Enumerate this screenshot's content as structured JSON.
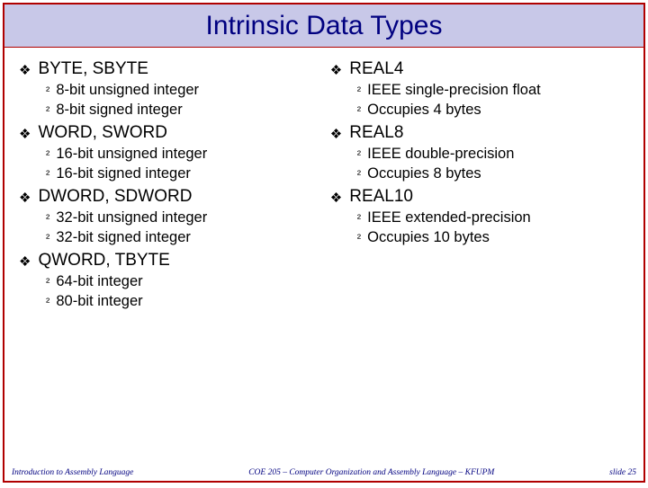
{
  "title": "Intrinsic Data Types",
  "left": [
    {
      "label": "BYTE, SBYTE",
      "sub": [
        "8-bit unsigned integer",
        "8-bit signed integer"
      ]
    },
    {
      "label": "WORD, SWORD",
      "sub": [
        "16-bit unsigned integer",
        "16-bit signed integer"
      ]
    },
    {
      "label": "DWORD, SDWORD",
      "sub": [
        "32-bit unsigned integer",
        "32-bit signed integer"
      ]
    },
    {
      "label": "QWORD, TBYTE",
      "sub": [
        "64-bit integer",
        "80-bit integer"
      ]
    }
  ],
  "right": [
    {
      "label": "REAL4",
      "sub": [
        "IEEE single-precision float",
        "Occupies 4 bytes"
      ]
    },
    {
      "label": "REAL8",
      "sub": [
        "IEEE double-precision",
        "Occupies 8 bytes"
      ]
    },
    {
      "label": "REAL10",
      "sub": [
        "IEEE extended-precision",
        "Occupies 10 bytes"
      ]
    }
  ],
  "footer": {
    "left": "Introduction to Assembly Language",
    "center": "COE 205 – Computer Organization and Assembly Language – KFUPM",
    "right": "slide 25"
  },
  "bullets": {
    "l1": "❖",
    "l2": "²"
  }
}
